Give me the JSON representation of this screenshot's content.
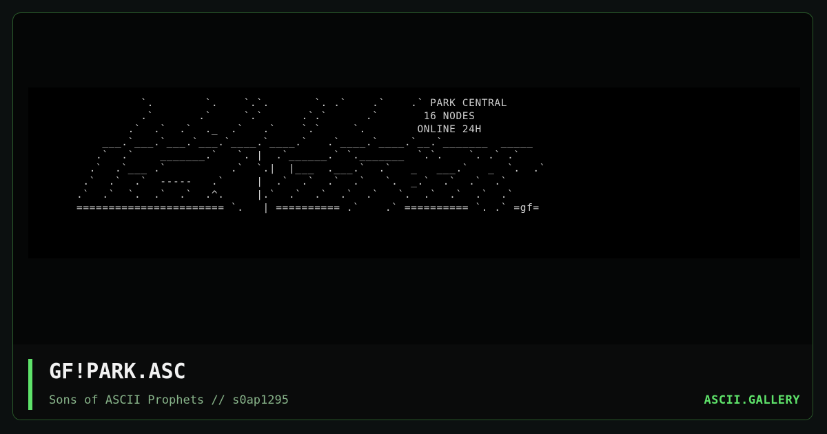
{
  "artwork": {
    "ascii": "          `.        `.    `.`.       `. .`    .`    .` PARK CENTRAL\n          .`       .`     `.`      .`.`      .`       16 NODES\n        .`  .`  .`  ._  .`   .`    `.`     `.        ONLINE 24H\n    ___.`___.`___.`___.`____.`____.`   .`____.`____.`__.`_______  _____\n   .`  .`    _______.`   `. |  .`______.` `._______  `.`.    `. .` .`\n  .`  .`___ .`          .`  `.|  |___  .___.`  .`   _   ___.`   _  `.  .`\n .`  .`  .`  -----   .`     |  .`  .`  .`  .`   `.  _.`  .`  .`  .`\n.`  .`  `.  .`  .`  .^.     |.`  .`  .`  .`  .`   `.  .`  .`  .`  .`\n======================= `.   | ========== .`    .` ========== `. .` =gf="
  },
  "footer": {
    "title": "GF!PARK.ASC",
    "subtitle": "Sons of ASCII Prophets // s0ap1295",
    "brand": "ASCII.GALLERY"
  },
  "colors": {
    "accent": "#5ee26a",
    "frame_border": "#2a5a2a",
    "subtitle": "#88b48a",
    "background": "#0c1010"
  }
}
